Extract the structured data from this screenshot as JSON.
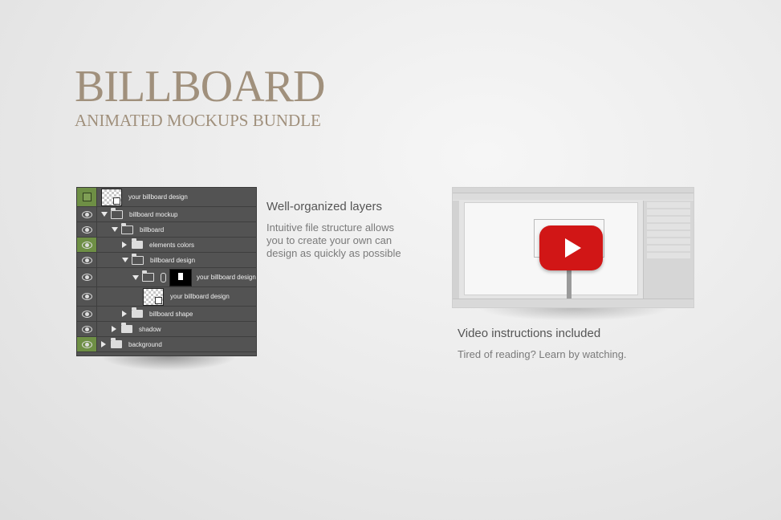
{
  "brand": {
    "title": "BILLBOARD",
    "subtitle": "ANIMATED MOCKUPS BUNDLE"
  },
  "layers_panel": {
    "rows": [
      {
        "label": "your billboard design",
        "eye": "box",
        "green": true,
        "indent": 0,
        "arrow": "none",
        "icon": "thumb"
      },
      {
        "label": "billboard mockup",
        "eye": "eye",
        "green": false,
        "indent": 0,
        "arrow": "down",
        "icon": "folder-open"
      },
      {
        "label": "billboard",
        "eye": "eye",
        "green": false,
        "indent": 1,
        "arrow": "down",
        "icon": "folder-open"
      },
      {
        "label": "elements colors",
        "eye": "eye",
        "green": true,
        "indent": 2,
        "arrow": "right",
        "icon": "folder"
      },
      {
        "label": "billboard design",
        "eye": "eye",
        "green": false,
        "indent": 2,
        "arrow": "down",
        "icon": "folder-open"
      },
      {
        "label": "your billboard design",
        "eye": "eye",
        "green": false,
        "indent": 3,
        "arrow": "down",
        "icon": "folder-mask"
      },
      {
        "label": "your billboard design",
        "eye": "eye",
        "green": false,
        "indent": 4,
        "arrow": "none",
        "icon": "thumb"
      },
      {
        "label": "billboard shape",
        "eye": "eye",
        "green": false,
        "indent": 2,
        "arrow": "right",
        "icon": "folder"
      },
      {
        "label": "shadow",
        "eye": "eye",
        "green": false,
        "indent": 1,
        "arrow": "right",
        "icon": "folder"
      },
      {
        "label": "background",
        "eye": "eye",
        "green": true,
        "indent": 0,
        "arrow": "right",
        "icon": "folder"
      }
    ]
  },
  "feature_layers": {
    "title": "Well-organized layers",
    "description": "Intuitive file structure allows you to create your own can design as quickly as possible"
  },
  "feature_video": {
    "title": "Video instructions included",
    "description": "Tired of reading? Learn by watching."
  },
  "colors": {
    "brand": "#a0907c",
    "panel": "#535353",
    "eye_green": "#6e8f45",
    "play_red": "#d11616"
  }
}
